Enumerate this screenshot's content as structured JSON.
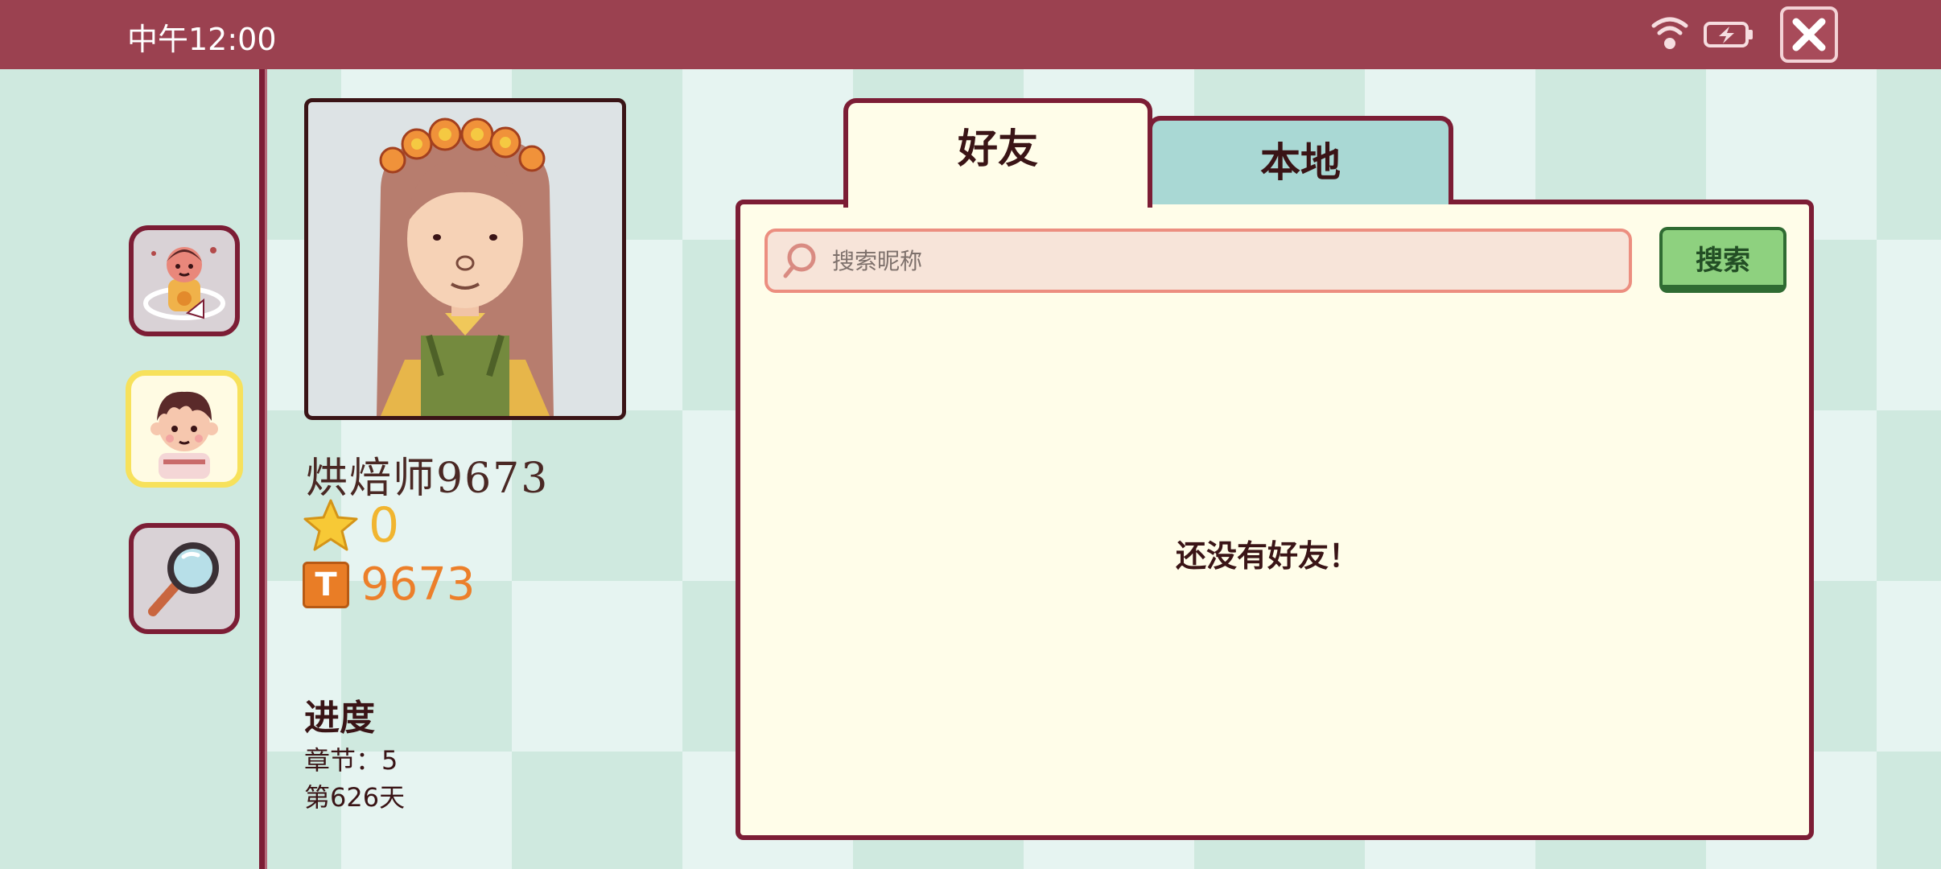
{
  "status_bar": {
    "time": "中午12:00"
  },
  "sidebar": {
    "items": [
      {
        "name": "customer-avatar",
        "active": false
      },
      {
        "name": "chef-avatar",
        "active": true
      },
      {
        "name": "search",
        "active": false
      }
    ]
  },
  "profile": {
    "name": "烘焙师9673",
    "stars": "0",
    "coins": "9673",
    "progress_title": "进度",
    "chapter": "章节：5",
    "day": "第626天"
  },
  "tabs": [
    {
      "label": "好友",
      "active": true
    },
    {
      "label": "本地",
      "active": false
    }
  ],
  "search": {
    "placeholder": "搜索昵称",
    "value": "",
    "button_label": "搜索"
  },
  "friends": {
    "empty_message": "还没有好友！"
  },
  "colors": {
    "top_bar": "#9b4150",
    "border": "#7c1d35",
    "panel_bg": "#fffde9",
    "inactive_tab": "#a9d8d4",
    "search_button": "#8ed17f",
    "star": "#f1b530",
    "coin": "#ec7f2a"
  }
}
